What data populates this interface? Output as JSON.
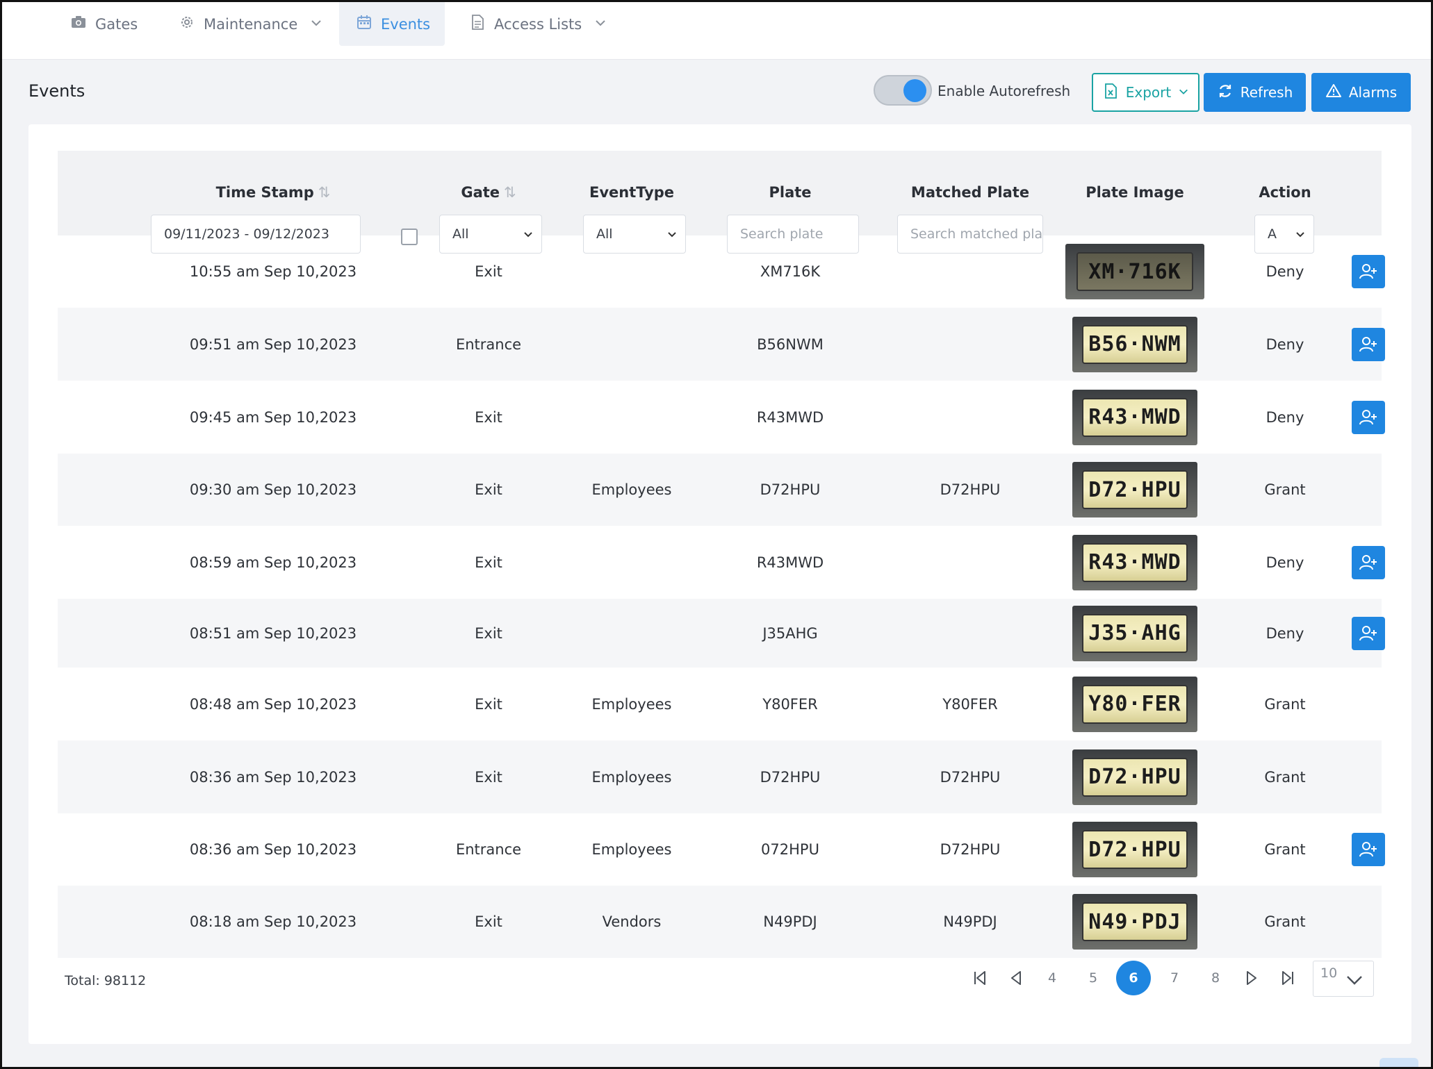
{
  "nav": {
    "tabs": [
      {
        "label": "Gates",
        "icon": "camera-icon"
      },
      {
        "label": "Maintenance",
        "icon": "gear-icon"
      },
      {
        "label": "Events",
        "icon": "calendar-icon",
        "active": true
      },
      {
        "label": "Access Lists",
        "icon": "document-icon"
      }
    ]
  },
  "header": {
    "title": "Events",
    "autorefresh_label": "Enable Autorefresh",
    "autorefresh_on": true,
    "export_label": "Export",
    "refresh_label": "Refresh",
    "alarms_label": "Alarms"
  },
  "table": {
    "columns": [
      "Time Stamp",
      "Gate",
      "EventType",
      "Plate",
      "Matched Plate",
      "Plate Image",
      "Action"
    ],
    "sort_glyph": "⇅",
    "filters": {
      "date_range": "09/11/2023 - 09/12/2023",
      "gate": "All",
      "event_type": "All",
      "plate_placeholder": "Search plate",
      "matched_placeholder": "Search matched plate",
      "action": "A"
    },
    "rows": [
      {
        "time": "10:55 am Sep 10,2023",
        "gate": "Exit",
        "event_type": "",
        "plate": "XM716K",
        "matched": "",
        "image_text": "XM·716K",
        "action": "Deny",
        "add_button": true
      },
      {
        "time": "09:51 am Sep 10,2023",
        "gate": "Entrance",
        "event_type": "",
        "plate": "B56NWM",
        "matched": "",
        "image_text": "B56·NWM",
        "action": "Deny",
        "add_button": true
      },
      {
        "time": "09:45 am Sep 10,2023",
        "gate": "Exit",
        "event_type": "",
        "plate": "R43MWD",
        "matched": "",
        "image_text": "R43·MWD",
        "action": "Deny",
        "add_button": true
      },
      {
        "time": "09:30 am Sep 10,2023",
        "gate": "Exit",
        "event_type": "Employees",
        "plate": "D72HPU",
        "matched": "D72HPU",
        "image_text": "D72·HPU",
        "action": "Grant",
        "add_button": false
      },
      {
        "time": "08:59 am Sep 10,2023",
        "gate": "Exit",
        "event_type": "",
        "plate": "R43MWD",
        "matched": "",
        "image_text": "R43·MWD",
        "action": "Deny",
        "add_button": true
      },
      {
        "time": "08:51 am Sep 10,2023",
        "gate": "Exit",
        "event_type": "",
        "plate": "J35AHG",
        "matched": "",
        "image_text": "J35·AHG",
        "action": "Deny",
        "add_button": true
      },
      {
        "time": "08:48 am Sep 10,2023",
        "gate": "Exit",
        "event_type": "Employees",
        "plate": "Y80FER",
        "matched": "Y80FER",
        "image_text": "Y80·FER",
        "action": "Grant",
        "add_button": false
      },
      {
        "time": "08:36 am Sep 10,2023",
        "gate": "Exit",
        "event_type": "Employees",
        "plate": "D72HPU",
        "matched": "D72HPU",
        "image_text": "D72·HPU",
        "action": "Grant",
        "add_button": false
      },
      {
        "time": "08:36 am Sep 10,2023",
        "gate": "Entrance",
        "event_type": "Employees",
        "plate": "072HPU",
        "matched": "D72HPU",
        "image_text": "D72·HPU",
        "action": "Grant",
        "add_button": true
      },
      {
        "time": "08:18 am Sep 10,2023",
        "gate": "Exit",
        "event_type": "Vendors",
        "plate": "N49PDJ",
        "matched": "N49PDJ",
        "image_text": "N49·PDJ",
        "action": "Grant",
        "add_button": false
      }
    ]
  },
  "footer": {
    "total_label": "Total: 98112",
    "pages": [
      "4",
      "5",
      "6",
      "7",
      "8"
    ],
    "current_page": "6",
    "page_size": "10"
  },
  "colors": {
    "primary": "#1f86e0",
    "export": "#1aa3a3",
    "active_tab": "#3b8fe0"
  }
}
